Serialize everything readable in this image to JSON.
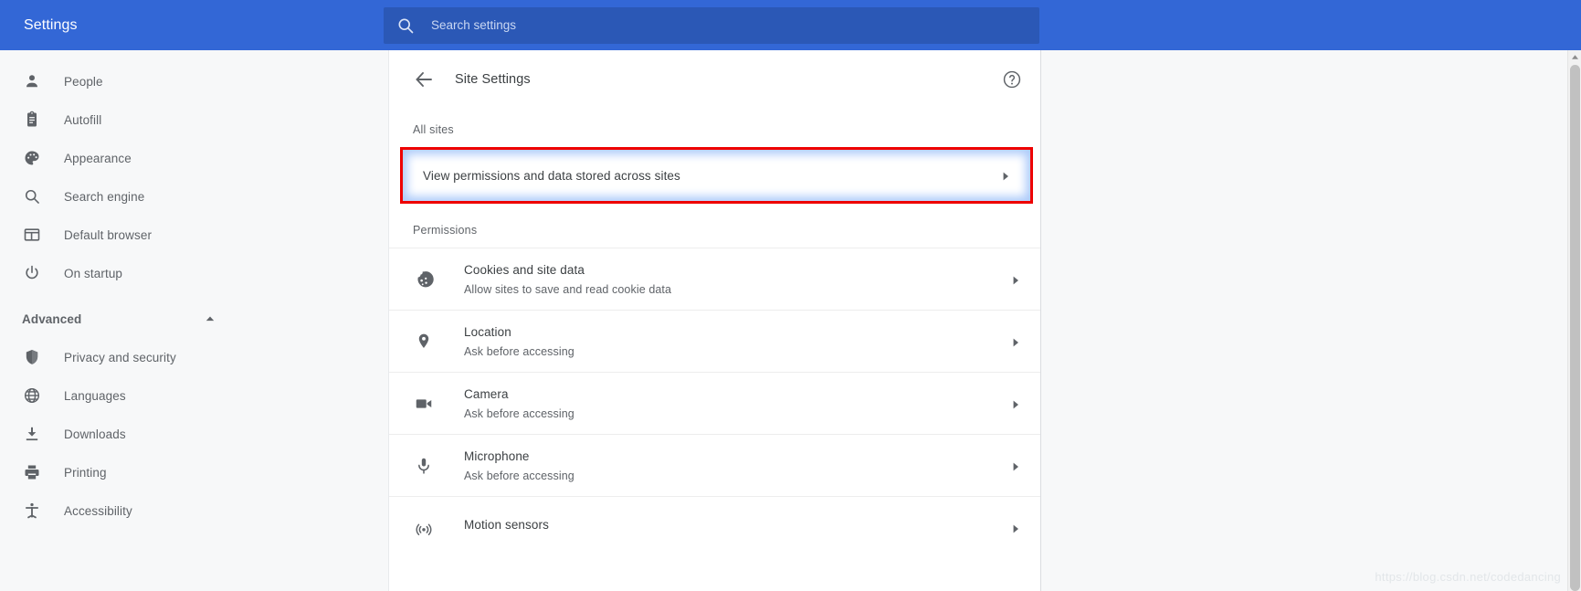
{
  "topbar": {
    "brand": "Settings",
    "search": {
      "placeholder": "Search settings",
      "value": "",
      "icon": "search-icon"
    },
    "bg_color": "#3367d6",
    "search_bg_color": "#2b58b6"
  },
  "sidebar": {
    "items": [
      {
        "label": "People",
        "icon": "person-icon"
      },
      {
        "label": "Autofill",
        "icon": "clipboard-icon"
      },
      {
        "label": "Appearance",
        "icon": "palette-icon"
      },
      {
        "label": "Search engine",
        "icon": "search-icon"
      },
      {
        "label": "Default browser",
        "icon": "browser-window-icon"
      },
      {
        "label": "On startup",
        "icon": "power-icon"
      }
    ],
    "group": {
      "label": "Advanced",
      "expanded": true,
      "icon": "chevron-up-icon"
    },
    "advanced_items": [
      {
        "label": "Privacy and security",
        "icon": "shield-icon"
      },
      {
        "label": "Languages",
        "icon": "globe-icon"
      },
      {
        "label": "Downloads",
        "icon": "download-icon"
      },
      {
        "label": "Printing",
        "icon": "printer-icon"
      },
      {
        "label": "Accessibility",
        "icon": "accessibility-icon"
      }
    ]
  },
  "main": {
    "back_icon": "arrow-left-icon",
    "title": "Site Settings",
    "help_icon": "help-circle-icon",
    "all_sites": {
      "section_label": "All sites",
      "row_label": "View permissions and data stored across sites",
      "chevron_icon": "chevron-right-icon",
      "highlight_border_color": "#ee0000",
      "highlight_glow_color": "#aecbfa"
    },
    "permissions": {
      "section_label": "Permissions",
      "rows": [
        {
          "title": "Cookies and site data",
          "subtitle": "Allow sites to save and read cookie data",
          "icon": "cookie-icon",
          "chevron_icon": "chevron-right-icon"
        },
        {
          "title": "Location",
          "subtitle": "Ask before accessing",
          "icon": "location-pin-icon",
          "chevron_icon": "chevron-right-icon"
        },
        {
          "title": "Camera",
          "subtitle": "Ask before accessing",
          "icon": "video-camera-icon",
          "chevron_icon": "chevron-right-icon"
        },
        {
          "title": "Microphone",
          "subtitle": "Ask before accessing",
          "icon": "microphone-icon",
          "chevron_icon": "chevron-right-icon"
        },
        {
          "title": "Motion sensors",
          "subtitle": "",
          "icon": "motion-sensor-icon",
          "chevron_icon": "chevron-right-icon"
        }
      ]
    }
  },
  "scrollbar": {
    "up_arrow_icon": "scroll-up-arrow-icon"
  },
  "watermark": "https://blog.csdn.net/codedancing"
}
